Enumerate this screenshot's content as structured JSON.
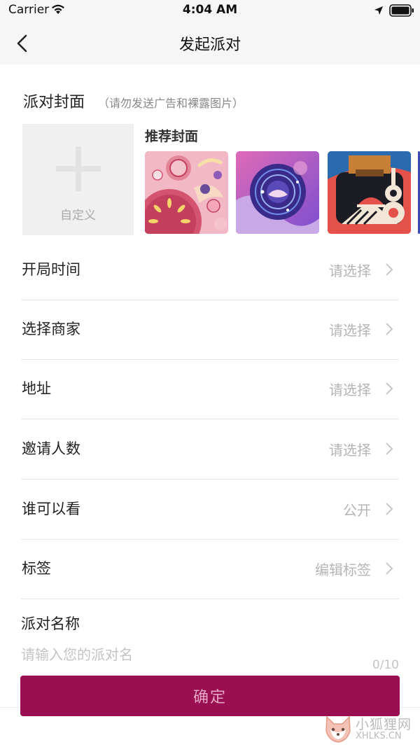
{
  "status_bar": {
    "carrier": "Carrier",
    "time": "4:04 AM"
  },
  "nav": {
    "title": "发起派对"
  },
  "cover": {
    "title": "派对封面",
    "hint": "（请勿发送广告和裸露图片）",
    "custom_label": "自定义",
    "recommended_title": "推荐封面"
  },
  "rows": [
    {
      "label": "开局时间",
      "value": "请选择"
    },
    {
      "label": "选择商家",
      "value": "请选择"
    },
    {
      "label": "地址",
      "value": "请选择"
    },
    {
      "label": "邀请人数",
      "value": "请选择"
    },
    {
      "label": "谁可以看",
      "value": "公开"
    },
    {
      "label": "标签",
      "value": "编辑标签"
    }
  ],
  "party_name": {
    "title": "派对名称",
    "placeholder": "请输入您的派对名",
    "value": "",
    "counter": "0/10"
  },
  "confirm_label": "确定",
  "watermark": {
    "cn": "小狐狸网",
    "en": "XHLKS.CN"
  },
  "colors": {
    "primary": "#9a0f52",
    "placeholder": "#c4c4c4",
    "nav_bg": "#f6f6f6"
  }
}
